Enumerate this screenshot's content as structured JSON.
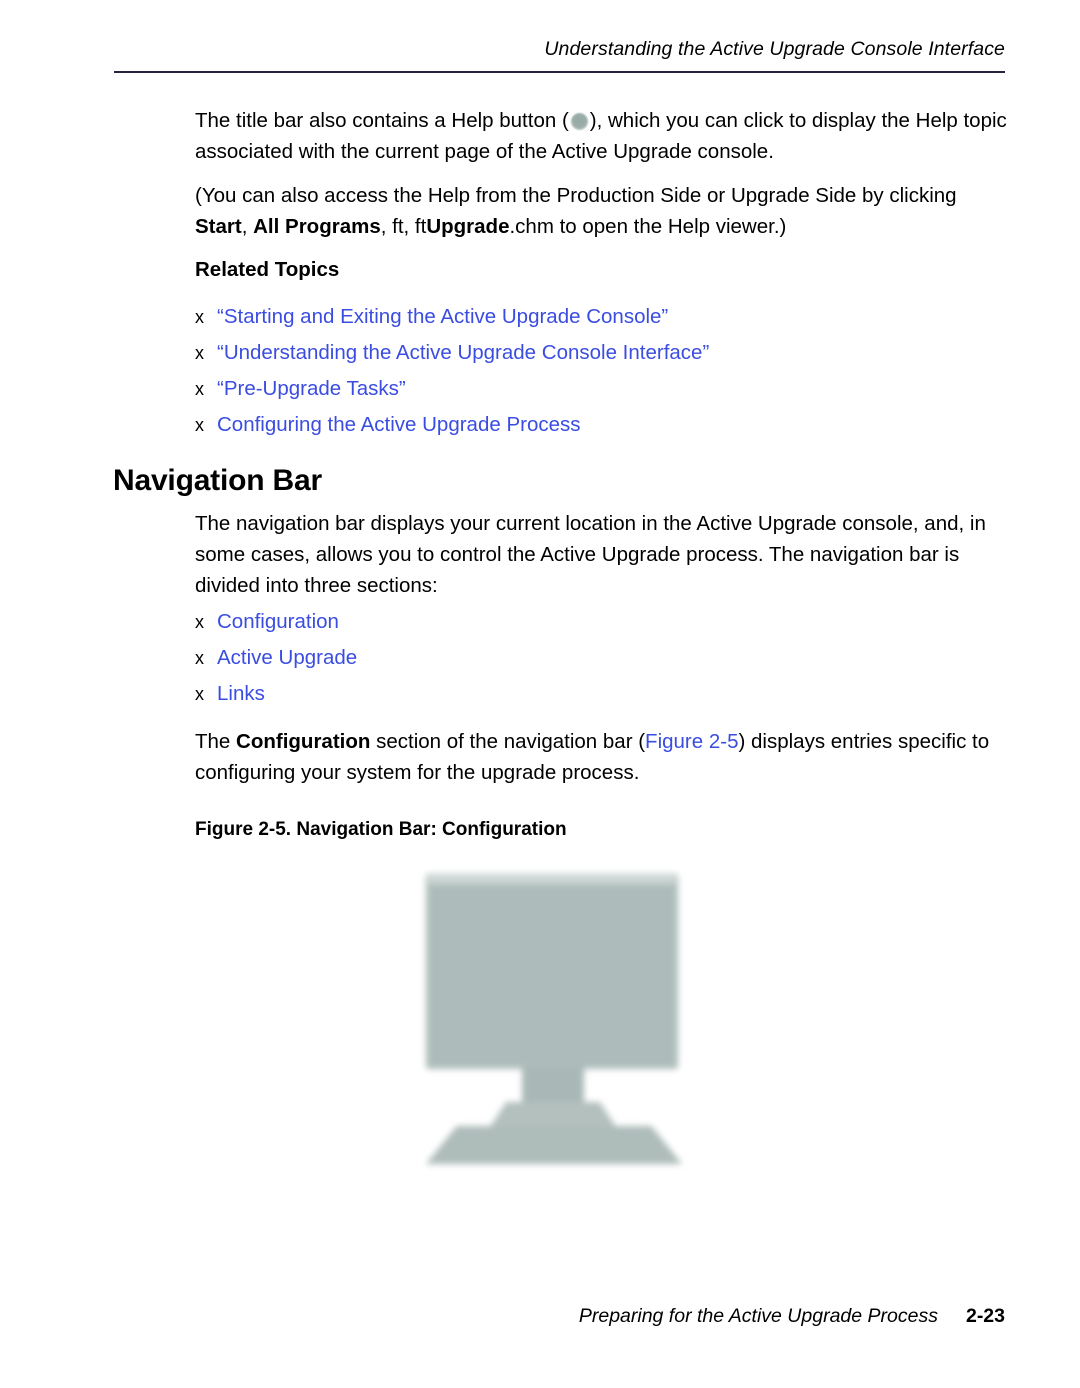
{
  "header": {
    "running_title": "Understanding the Active Upgrade Console Interface"
  },
  "body": {
    "para1_part1": "The title bar also contains a Help button (",
    "help_icon_name": "help-button-icon",
    "para1_part2": "), which you can click to display the Help topic associated with the current page of the Active Upgrade console.",
    "para2_part1": "(You can also access the Help from the Production Side or Upgrade Side by clicking ",
    "para2_bold1": "Start",
    "para2_sep1": ", ",
    "para2_bold2": "All Programs",
    "para2_sep2": ", ft, ft",
    "para2_bold3": "Upgrade",
    "para2_tail": ".chm  to open the Help viewer.)"
  },
  "related_topics": {
    "heading": "Related Topics",
    "bullet_marker": "x",
    "items": [
      {
        "label": "“Starting and Exiting the Active Upgrade Console”"
      },
      {
        "label": "“Understanding the Active Upgrade Console Interface”"
      },
      {
        "label": "“Pre-Upgrade Tasks”"
      },
      {
        "label": "Configuring the Active Upgrade Process"
      }
    ]
  },
  "section": {
    "title": "Navigation Bar",
    "intro": "The navigation bar displays your current location in the Active Upgrade console, and, in some cases, allows you to control the Active Upgrade process. The navigation bar is divided into three sections:",
    "bullet_marker": "x",
    "sections": [
      {
        "label": "Configuration"
      },
      {
        "label": "Active Upgrade"
      },
      {
        "label": "Links"
      }
    ],
    "config_para_part1": "The ",
    "config_para_bold": "Configuration",
    "config_para_part2": " section of the navigation bar (",
    "config_para_xref": "Figure 2-5",
    "config_para_part3": ") displays entries specific to configuring your system for the upgrade process."
  },
  "figure": {
    "caption": "Figure 2-5. Navigation Bar: Configuration",
    "image_name": "navigation-bar-configuration-screenshot",
    "image_description": "computer-monitor-placeholder"
  },
  "footer": {
    "title": "Preparing for the Active Upgrade Process",
    "page_number": "2-23"
  },
  "colors": {
    "link": "#3a4de0",
    "rule": "#24243c",
    "figure_body": "#aebdbb",
    "figure_bezel": "#cfd8d6",
    "text": "#000000"
  }
}
